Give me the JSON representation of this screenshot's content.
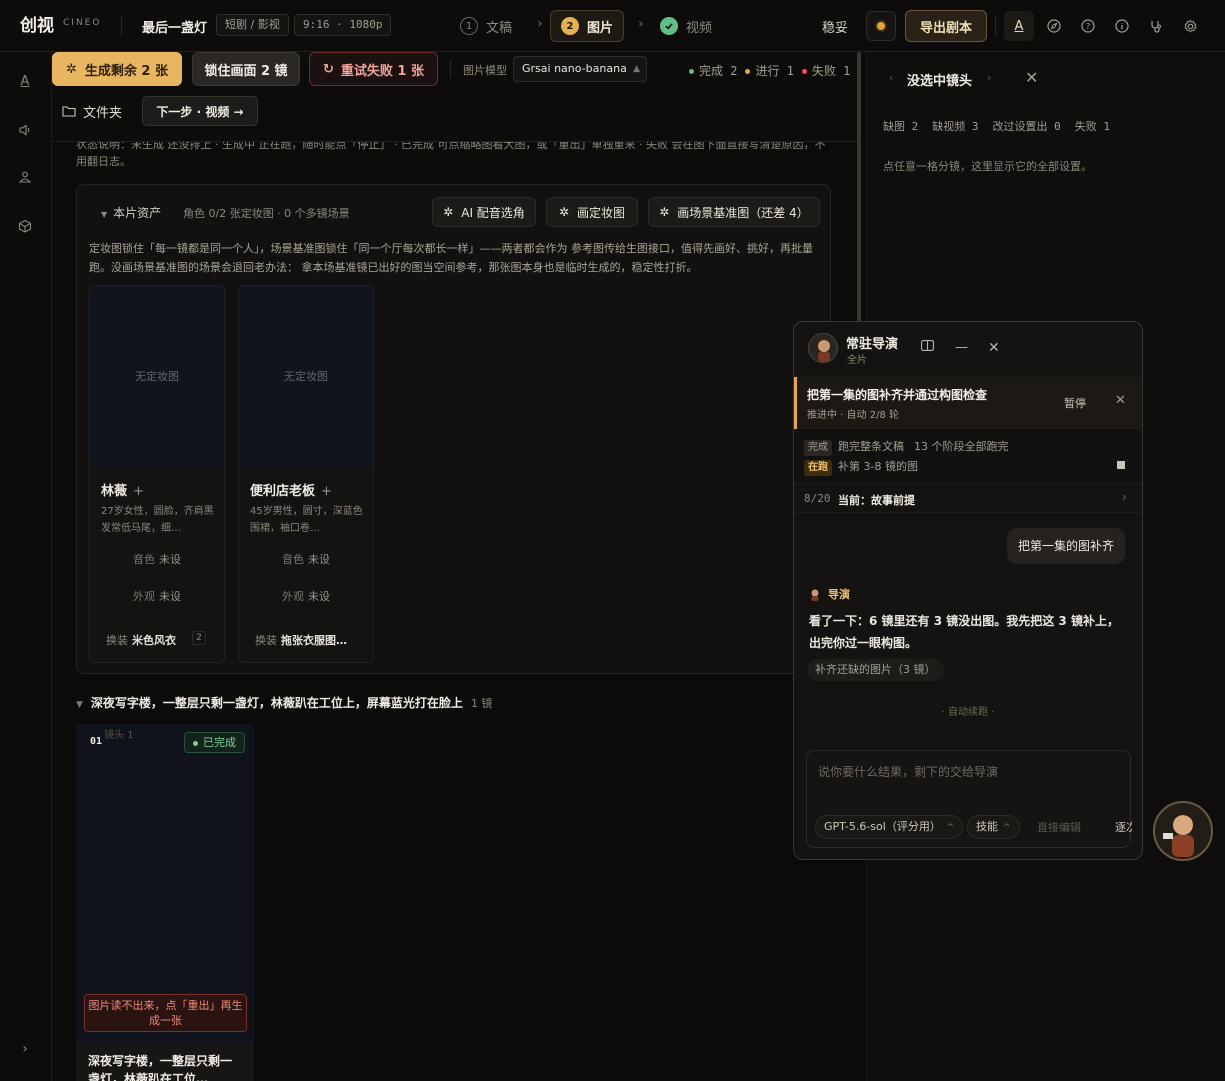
{
  "app": {
    "logo": "创视",
    "logo_sub": "CINEO"
  },
  "project": {
    "title": "最后一盏灯",
    "genre": "短剧 / 影视",
    "format": "9:16 · 1080p"
  },
  "steps": [
    {
      "num": "1",
      "label": "文稿",
      "state": "todo"
    },
    {
      "num": "2",
      "label": "图片",
      "state": "active"
    },
    {
      "num": "",
      "label": "视频",
      "state": "done"
    }
  ],
  "top_right": {
    "stable_label": "稳妥",
    "export_label": "导出剧本"
  },
  "actions": {
    "generate_label": "生成剩余 2 张",
    "lock_label": "锁住画面 2 镜",
    "retry_label": "重试失败 1 张",
    "model_label": "图片模型",
    "model_value": "Grsai nano-banana",
    "status": {
      "done": "完成 2",
      "running": "进行 1",
      "failed": "失败 1"
    },
    "folder_label": "文件夹",
    "next_label": "下一步 · 视频 →"
  },
  "hint": "状态说明：未生成 还没排上 · 生成中 正在跑，随时能点「停止」 · 已完成 可点缩略图看大图，或「重出」单独重来 · 失败 会在图下面直接写清楚原因，不用翻日志。",
  "assets": {
    "title": "本片资产",
    "subtitle": "角色 0/2 张定妆图 · 0 个多镜场景",
    "btn_voice": "AI 配音选角",
    "btn_makeup": "画定妆图",
    "btn_scene": "画场景基准图（还差 4）",
    "desc": "定妆图锁住「每一镜都是同一个人」，场景基准图锁住「同一个厅每次都长一样」——两者都会作为 参考图传给生图接口，值得先画好、挑好，再批量跑。没画场景基准图的场景会退回老办法： 拿本场基准镜已出好的图当空间参考，那张图本身也是临时生成的，稳定性打折。",
    "characters": [
      {
        "placeholder": "无定妆图",
        "name": "林薇",
        "desc": "27岁女性，圆脸，齐肩黑发常低马尾，细…",
        "voice_label": "音色",
        "voice_value": "未设",
        "look_label": "外观",
        "look_value": "未设",
        "outfit_label": "换装",
        "outfit_value": "米色风衣",
        "outfit_count": "2"
      },
      {
        "placeholder": "无定妆图",
        "name": "便利店老板",
        "desc": "45岁男性，圆寸，深蓝色围裙，袖口卷…",
        "voice_label": "音色",
        "voice_value": "未设",
        "look_label": "外观",
        "look_value": "未设",
        "outfit_label": "换装",
        "outfit_value": "拖张衣服图…",
        "outfit_count": ""
      }
    ]
  },
  "scene": {
    "title": "深夜写字楼，一整层只剩一盏灯，林薇趴在工位上，屏幕蓝光打在脸上",
    "shots_label": "1 镜",
    "shot": {
      "num": "01",
      "faint": "镜头 1",
      "status": "已完成",
      "error": "图片读不出来，点「重出」再生成一张",
      "caption": "深夜写字楼，一整层只剩一盏灯，林薇趴在工位…"
    }
  },
  "right_panel": {
    "title": "没选中镜头",
    "stats": [
      "缺图 2",
      "缺视频 3",
      "改过设置出 0",
      "失败 1"
    ],
    "tip": "点任意一格分镜，这里显示它的全部设置。"
  },
  "director": {
    "title": "常驻导演",
    "subtitle": "全片",
    "task_title": "把第一集的图补齐并通过构图检查",
    "task_status": "推进中 · 自动 2/8 轮",
    "pause_label": "暂停",
    "progress": [
      {
        "tag": "完成",
        "text": "跑完整条文稿",
        "extra": "13 个阶段全部跑完"
      },
      {
        "tag": "在跑",
        "text": "补第 3-8 镜的图",
        "extra": ""
      }
    ],
    "current_count": "8/20",
    "current_label": "当前：故事前提",
    "user_msg": "把第一集的图补齐",
    "reply_name": "导演",
    "reply": "看了一下：6 镜里还有 3 镜没出图。我先把这 3 镜补上，出完你过一眼构图。",
    "chip": "补齐还缺的图片（3 镜）",
    "autorun": "· 自动续跑 ·",
    "input_placeholder": "说你要什么结果，剩下的交给导演",
    "model_select": "GPT-5.6-sol（评分用）",
    "skill_select": "技能",
    "direct_edit": "直接编辑",
    "confirm_each": "逐次确认"
  },
  "colors": {
    "accent": "#e8b661",
    "done": "#5fbf86",
    "running": "#e2a74e",
    "failed": "#e4574a"
  }
}
